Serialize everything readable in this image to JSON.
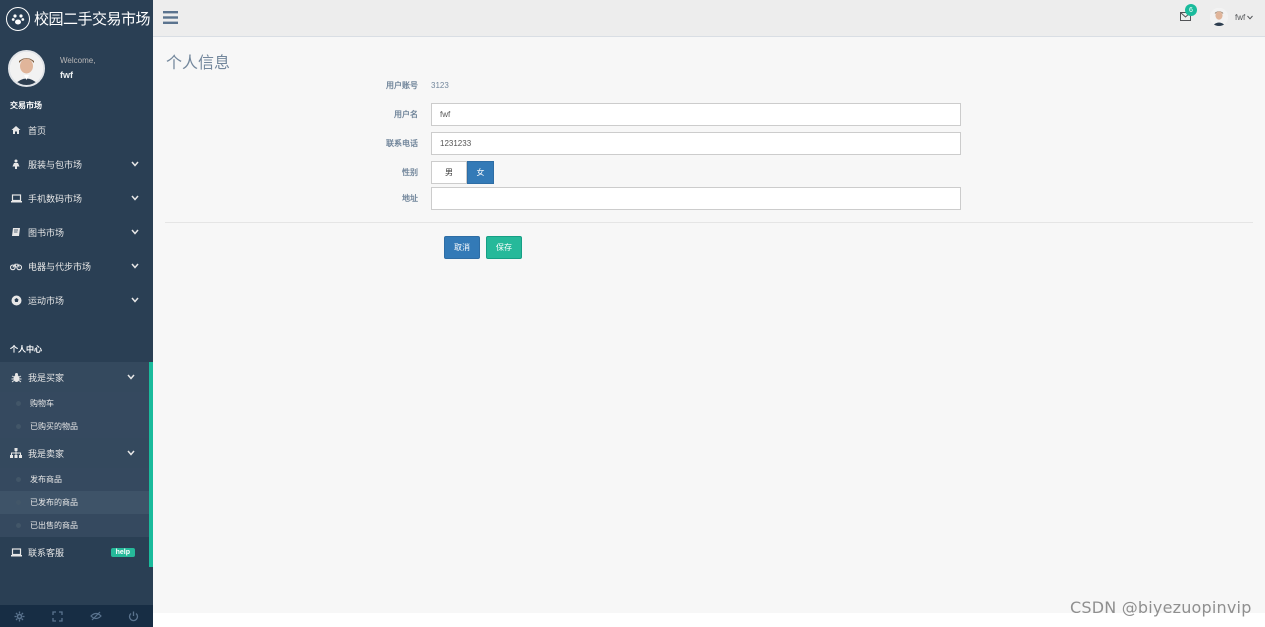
{
  "brand": {
    "title": "校园二手交易市场",
    "logo_icon": "paw-icon"
  },
  "profile": {
    "welcome": "Welcome,",
    "username": "fwf"
  },
  "sidebar": {
    "market_section": "交易市场",
    "market_items": [
      {
        "label": "首页",
        "icon": "home-icon"
      },
      {
        "label": "服装与包市场",
        "icon": "female-icon"
      },
      {
        "label": "手机数码市场",
        "icon": "laptop-icon"
      },
      {
        "label": "图书市场",
        "icon": "book-icon"
      },
      {
        "label": "电器与代步市场",
        "icon": "bicycle-icon"
      },
      {
        "label": "运动市场",
        "icon": "futbol-icon"
      }
    ],
    "personal_section": "个人中心",
    "buyer": {
      "label": "我是买家",
      "items": [
        "购物车",
        "已购买的物品"
      ]
    },
    "seller": {
      "label": "我是卖家",
      "items": [
        "发布商品",
        "已发布的商品",
        "已出售的商品"
      ]
    },
    "contact": {
      "label": "联系客服",
      "badge": "help"
    }
  },
  "topnav": {
    "mail_count": "6",
    "username": "fwf"
  },
  "main": {
    "page_title": "个人信息",
    "account_label": "用户账号",
    "account_value": "3123",
    "username_label": "用户名",
    "username_value": "fwf",
    "phone_label": "联系电话",
    "phone_value": "1231233",
    "gender_label": "性别",
    "gender_options": [
      "男",
      "女"
    ],
    "gender_selected": "女",
    "address_label": "地址",
    "address_value": "",
    "cancel_label": "取消",
    "save_label": "保存"
  },
  "watermark": "CSDN @biyezuopinvip",
  "colors": {
    "sidebar": "#2a3f54",
    "accent": "#1abb9c",
    "primary": "#337ab7",
    "success": "#26b99a"
  }
}
